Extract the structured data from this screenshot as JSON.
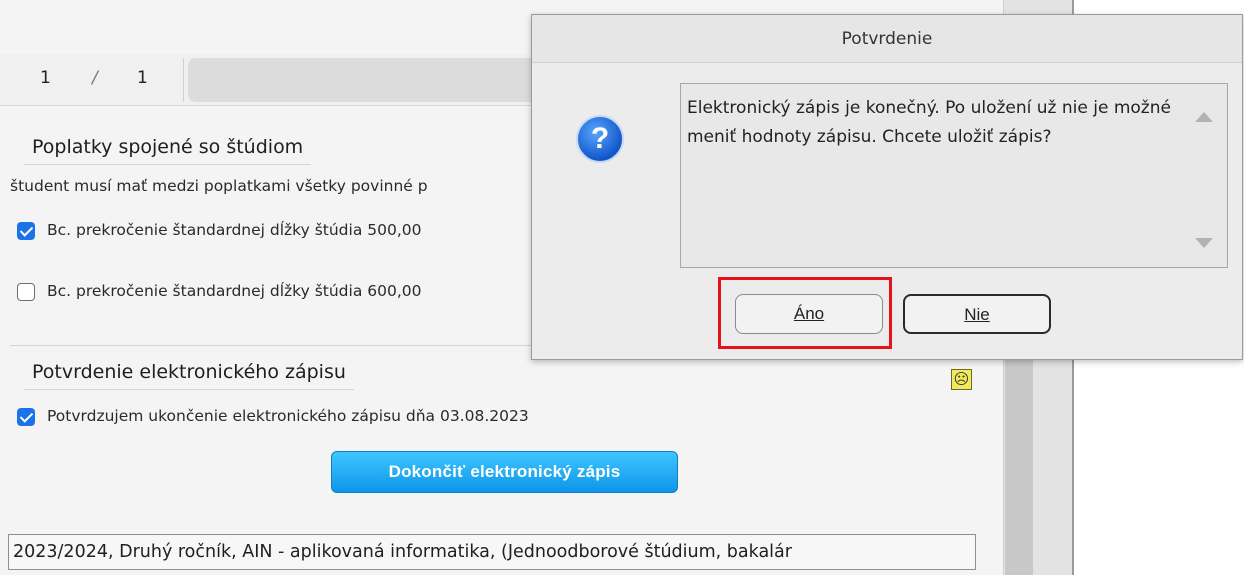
{
  "pager": {
    "current": "1",
    "separator": "/",
    "total": "1"
  },
  "fees": {
    "title": "Poplatky spojené so štúdiom",
    "note": "študent musí mať medzi poplatkami všetky povinné p",
    "items": [
      {
        "label": "Bc. prekročenie štandardnej dĺžky štúdia 500,00 ",
        "checked": true
      },
      {
        "label": "Bc. prekročenie štandardnej dĺžky štúdia 600,00 ",
        "checked": false
      }
    ]
  },
  "confirmation": {
    "title": "Potvrdenie elektronického zápisu",
    "checkbox_label": "Potvrdzujem ukončenie elektronického zápisu dňa 03.08.2023",
    "checked": true,
    "finish_button": "Dokončiť elektronický zápis"
  },
  "study_info": "2023/2024, Druhý ročník, AIN - aplikovaná informatika, (Jednoodborové štúdium, bakalár",
  "dialog": {
    "title": "Potvrdenie",
    "icon": "question-icon",
    "message": "Elektronický zápis je konečný. Po uložení už nie je možné meniť hodnoty zápisu. Chcete uložiť zápis?",
    "yes_button": "Áno",
    "no_button": "Nie"
  },
  "colors": {
    "highlight": "#e4131b",
    "accent": "#1a73e8",
    "finish_button": "#0e95e8"
  }
}
